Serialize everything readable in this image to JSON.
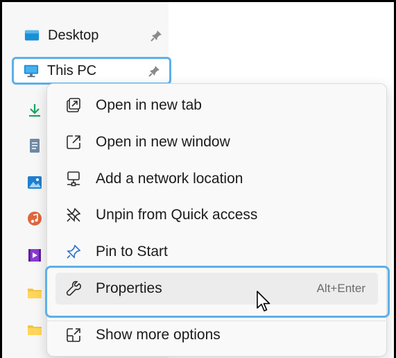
{
  "nav": {
    "items": [
      {
        "label": "Desktop",
        "icon": "desktop-folder-icon",
        "pinned": true
      },
      {
        "label": "This PC",
        "icon": "monitor-icon",
        "pinned": true,
        "selected": true
      }
    ],
    "side_icons": [
      "download-icon",
      "document-icon",
      "pictures-icon",
      "music-icon",
      "videos-icon",
      "folder-icon",
      "folder-icon"
    ]
  },
  "context_menu": {
    "items": [
      {
        "label": "Open in new tab",
        "icon": "open-new-tab-icon"
      },
      {
        "label": "Open in new window",
        "icon": "open-new-window-icon"
      },
      {
        "label": "Add a network location",
        "icon": "network-location-icon"
      },
      {
        "label": "Unpin from Quick access",
        "icon": "unpin-icon"
      },
      {
        "label": "Pin to Start",
        "icon": "pin-icon"
      },
      {
        "label": "Properties",
        "icon": "wrench-icon",
        "shortcut": "Alt+Enter",
        "hovered": true
      },
      {
        "label": "Show more options",
        "icon": "more-options-icon"
      }
    ]
  },
  "colors": {
    "highlight": "#5cb0ea",
    "menu_bg": "#f9f9f9",
    "hover_bg": "#ececec"
  }
}
